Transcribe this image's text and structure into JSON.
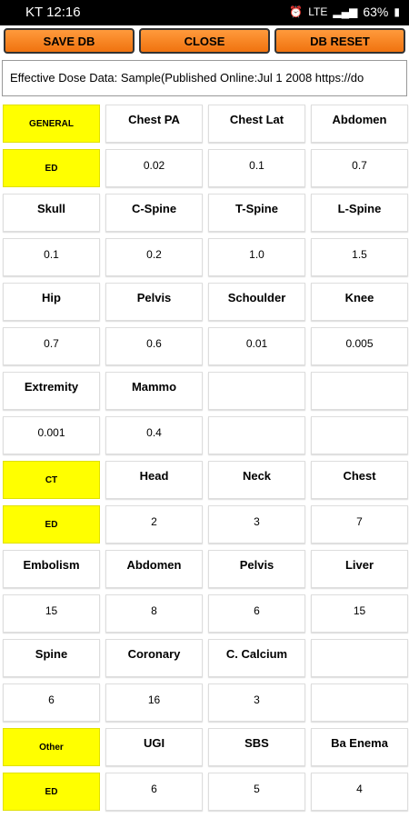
{
  "status_bar": {
    "carrier_time": "KT 12:16",
    "signal": "LTE",
    "battery": "63%"
  },
  "toolbar": {
    "save_label": "SAVE DB",
    "close_label": "CLOSE",
    "reset_label": "DB RESET"
  },
  "info_text": "Effective Dose Data: Sample(Published Online:Jul 1 2008  https://do",
  "sections": [
    {
      "rows": [
        {
          "cells": [
            "GENERAL",
            "Chest PA",
            "Chest Lat",
            "Abdomen"
          ],
          "label": true
        },
        {
          "cells": [
            "ED",
            "0.02",
            "0.1",
            "0.7"
          ],
          "label": true
        },
        {
          "cells": [
            "Skull",
            "C-Spine",
            "T-Spine",
            "L-Spine"
          ]
        },
        {
          "cells": [
            "0.1",
            "0.2",
            "1.0",
            "1.5"
          ]
        },
        {
          "cells": [
            "Hip",
            "Pelvis",
            "Schoulder",
            "Knee"
          ]
        },
        {
          "cells": [
            "0.7",
            "0.6",
            "0.01",
            "0.005"
          ]
        },
        {
          "cells": [
            "Extremity",
            "Mammo",
            "",
            ""
          ]
        },
        {
          "cells": [
            "0.001",
            "0.4",
            "",
            ""
          ]
        }
      ]
    },
    {
      "rows": [
        {
          "cells": [
            "CT",
            "Head",
            "Neck",
            "Chest"
          ],
          "label": true
        },
        {
          "cells": [
            "ED",
            "2",
            "3",
            "7"
          ],
          "label": true
        },
        {
          "cells": [
            "Embolism",
            "Abdomen",
            "Pelvis",
            "Liver"
          ]
        },
        {
          "cells": [
            "15",
            "8",
            "6",
            "15"
          ]
        },
        {
          "cells": [
            "Spine",
            "Coronary",
            "C. Calcium",
            ""
          ]
        },
        {
          "cells": [
            "6",
            "16",
            "3",
            ""
          ]
        }
      ]
    },
    {
      "rows": [
        {
          "cells": [
            "Other",
            "UGI",
            "SBS",
            "Ba Enema"
          ],
          "label": true
        },
        {
          "cells": [
            "ED",
            "6",
            "5",
            "4"
          ],
          "label": true
        }
      ]
    }
  ]
}
